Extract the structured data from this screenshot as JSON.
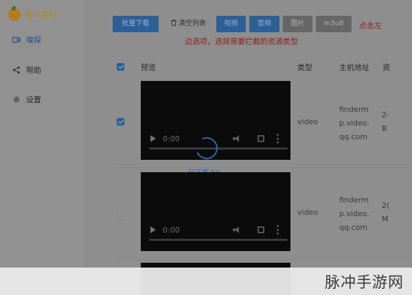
{
  "app": {
    "name": "猫爪素材"
  },
  "sidebar": {
    "items": [
      {
        "label": "嗅探",
        "icon": "video-icon",
        "active": true
      },
      {
        "label": "帮助",
        "icon": "share-icon",
        "active": false
      },
      {
        "label": "设置",
        "icon": "gear-icon",
        "active": false
      }
    ]
  },
  "toolbar": {
    "batch_download": "批量下载",
    "clear_list": "清空列表",
    "filters": [
      "视频",
      "音频",
      "图片",
      "m3u8"
    ],
    "click_left": "点击左",
    "hint": "边选项，选择需要拦截的资源类型"
  },
  "table": {
    "headers": {
      "preview": "预览",
      "type": "类型",
      "host": "主机地址",
      "extra": "资"
    },
    "rows": [
      {
        "checked": true,
        "time": "0:00",
        "type": "video",
        "host_lines": [
          "finderm",
          "p.video.",
          "qq.com"
        ],
        "extra_lines": [
          "2-",
          "B"
        ],
        "download_status": "已下载 5%"
      },
      {
        "checked": false,
        "time": "0:00",
        "type": "video",
        "host_lines": [
          "finderm",
          "p.video.",
          "qq.com"
        ],
        "extra_lines": [
          "2(",
          "M"
        ]
      }
    ]
  },
  "watermark": "脉冲手游网",
  "colors": {
    "accent": "#2e5f95",
    "warning": "#8e1d1d"
  }
}
